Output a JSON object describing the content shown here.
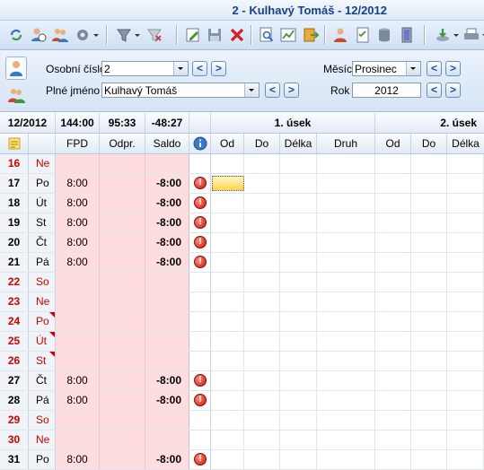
{
  "window": {
    "title": "2 - Kulhavý Tomáš - 12/2012"
  },
  "colors": {
    "weekend_red": "#d40000",
    "pink_fill": "#fddddd",
    "header_blue": "#15428b"
  },
  "toolbar": {
    "buttons": [
      "refresh-icon",
      "person-clock-icon",
      "people-icon",
      "gear-icon",
      "filter-icon",
      "clear-filter-icon",
      "edit-icon",
      "save-icon",
      "delete-icon",
      "preview-icon",
      "chart-icon",
      "export-icon",
      "user-icon",
      "checklist-icon",
      "database-icon",
      "door-icon",
      "download-icon",
      "print-icon"
    ]
  },
  "filter": {
    "osobni_cislo_label": "Osobní číslo",
    "osobni_cislo_value": "2",
    "plne_jmeno_label": "Plné jméno",
    "plne_jmeno_value": "Kulhavý Tomáš",
    "mesic_label": "Měsíc",
    "mesic_value": "Prosinec",
    "rok_label": "Rok",
    "rok_value": "2012",
    "prev": "<",
    "next": ">"
  },
  "grid": {
    "header1": {
      "period": "12/2012",
      "fpd_total": "144:00",
      "odpr_total": "95:33",
      "saldo_total": "-48:27",
      "usek1": "1. úsek",
      "usek2": "2. úsek"
    },
    "header2": {
      "fpd": "FPD",
      "odpr": "Odpr.",
      "saldo": "Saldo",
      "od": "Od",
      "do": "Do",
      "delka": "Délka",
      "druh": "Druh"
    },
    "rows": [
      {
        "day": "16",
        "wd": "Ne",
        "fpd": "",
        "saldo": "",
        "weekend": true,
        "alert": false,
        "corner": false
      },
      {
        "day": "17",
        "wd": "Po",
        "fpd": "8:00",
        "saldo": "-8:00",
        "weekend": false,
        "alert": true,
        "corner": false
      },
      {
        "day": "18",
        "wd": "Út",
        "fpd": "8:00",
        "saldo": "-8:00",
        "weekend": false,
        "alert": true,
        "corner": false
      },
      {
        "day": "19",
        "wd": "St",
        "fpd": "8:00",
        "saldo": "-8:00",
        "weekend": false,
        "alert": true,
        "corner": false
      },
      {
        "day": "20",
        "wd": "Čt",
        "fpd": "8:00",
        "saldo": "-8:00",
        "weekend": false,
        "alert": true,
        "corner": false
      },
      {
        "day": "21",
        "wd": "Pá",
        "fpd": "8:00",
        "saldo": "-8:00",
        "weekend": false,
        "alert": true,
        "corner": false
      },
      {
        "day": "22",
        "wd": "So",
        "fpd": "",
        "saldo": "",
        "weekend": true,
        "alert": false,
        "corner": false
      },
      {
        "day": "23",
        "wd": "Ne",
        "fpd": "",
        "saldo": "",
        "weekend": true,
        "alert": false,
        "corner": false
      },
      {
        "day": "24",
        "wd": "Po",
        "fpd": "",
        "saldo": "",
        "weekend": true,
        "alert": false,
        "corner": true
      },
      {
        "day": "25",
        "wd": "Út",
        "fpd": "",
        "saldo": "",
        "weekend": true,
        "alert": false,
        "corner": true
      },
      {
        "day": "26",
        "wd": "St",
        "fpd": "",
        "saldo": "",
        "weekend": true,
        "alert": false,
        "corner": true
      },
      {
        "day": "27",
        "wd": "Čt",
        "fpd": "8:00",
        "saldo": "-8:00",
        "weekend": false,
        "alert": true,
        "corner": false
      },
      {
        "day": "28",
        "wd": "Pá",
        "fpd": "8:00",
        "saldo": "-8:00",
        "weekend": false,
        "alert": true,
        "corner": false
      },
      {
        "day": "29",
        "wd": "So",
        "fpd": "",
        "saldo": "",
        "weekend": true,
        "alert": false,
        "corner": false
      },
      {
        "day": "30",
        "wd": "Ne",
        "fpd": "",
        "saldo": "",
        "weekend": true,
        "alert": false,
        "corner": false
      },
      {
        "day": "31",
        "wd": "Po",
        "fpd": "8:00",
        "saldo": "-8:00",
        "weekend": false,
        "alert": true,
        "corner": false
      }
    ]
  }
}
